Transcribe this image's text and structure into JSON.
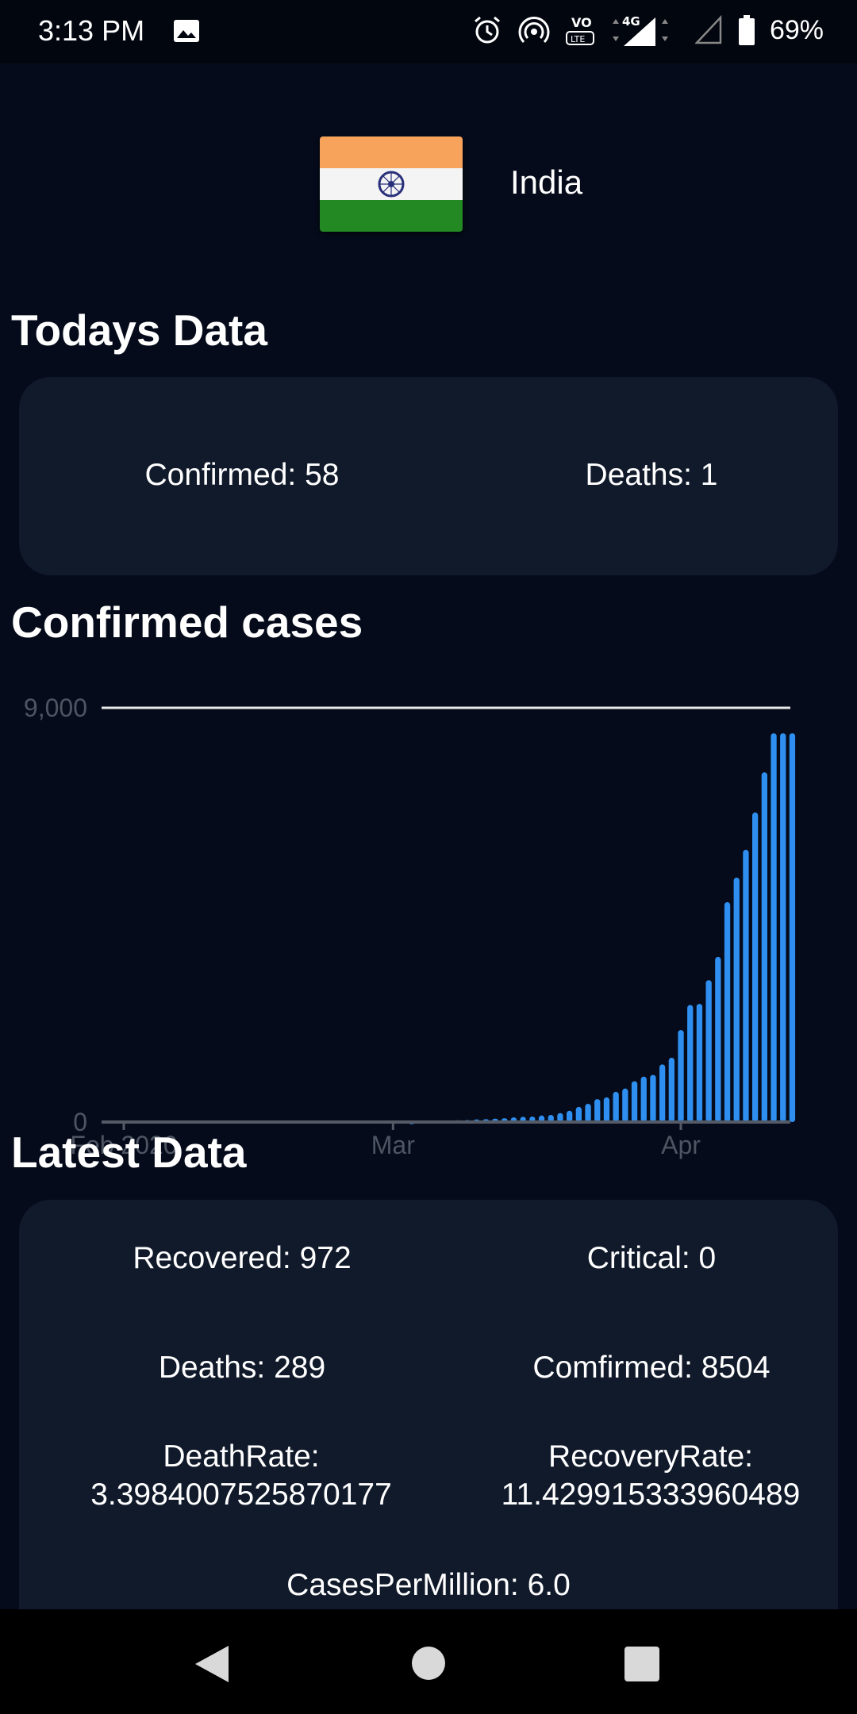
{
  "status_bar": {
    "time": "3:13 PM",
    "network": "4G",
    "battery": "69%",
    "icons": [
      "gallery-icon",
      "alarm-icon",
      "hotspot-icon",
      "volte-icon",
      "signal-icon",
      "battery-icon"
    ]
  },
  "header": {
    "country": "India",
    "flag_colors": [
      "#ff9933",
      "#ffffff",
      "#138808"
    ],
    "chakra_color": "#000080"
  },
  "today": {
    "title": "Todays Data",
    "confirmed": "Confirmed: 58",
    "deaths": "Deaths: 1"
  },
  "chart": {
    "title": "Confirmed cases"
  },
  "latest": {
    "title": "Latest Data",
    "recovered": "Recovered: 972",
    "critical": "Critical: 0",
    "deaths": "Deaths: 289",
    "confirmed": "Comfirmed: 8504",
    "death_rate_label": "DeathRate:",
    "death_rate_value": "3.3984007525870177",
    "recovery_rate_label": "RecoveryRate:",
    "recovery_rate_value": "11.429915333960489",
    "cases_per_million": "CasesPerMillion: 6.0"
  },
  "nav": {
    "icons": [
      "back-icon",
      "home-icon",
      "recents-icon"
    ]
  },
  "chart_data": {
    "type": "bar",
    "title": "",
    "xlabel": "",
    "ylabel": "",
    "ylim": [
      0,
      9000
    ],
    "y_ticks": [
      "0",
      "9,000"
    ],
    "x_ticks": [
      "Feb 2020",
      "Mar",
      "Apr"
    ],
    "x_tick_dates": [
      "2020-02-01",
      "2020-03-01",
      "2020-04-01"
    ],
    "grid": false,
    "bar_color": "#2f8ff0",
    "x": [
      "2020-03-03",
      "2020-03-04",
      "2020-03-05",
      "2020-03-06",
      "2020-03-07",
      "2020-03-08",
      "2020-03-09",
      "2020-03-10",
      "2020-03-11",
      "2020-03-12",
      "2020-03-13",
      "2020-03-14",
      "2020-03-15",
      "2020-03-16",
      "2020-03-17",
      "2020-03-18",
      "2020-03-19",
      "2020-03-20",
      "2020-03-21",
      "2020-03-22",
      "2020-03-23",
      "2020-03-24",
      "2020-03-25",
      "2020-03-26",
      "2020-03-27",
      "2020-03-28",
      "2020-03-29",
      "2020-03-30",
      "2020-03-31",
      "2020-04-01",
      "2020-04-02",
      "2020-04-03",
      "2020-04-04",
      "2020-04-05",
      "2020-04-06",
      "2020-04-07",
      "2020-04-08",
      "2020-04-09",
      "2020-04-10",
      "2020-04-11",
      "2020-04-12",
      "2020-04-13"
    ],
    "values": [
      5,
      28,
      30,
      31,
      34,
      39,
      43,
      56,
      62,
      73,
      82,
      102,
      113,
      119,
      142,
      156,
      194,
      244,
      330,
      396,
      499,
      536,
      657,
      727,
      887,
      987,
      1024,
      1251,
      1397,
      1998,
      2543,
      2567,
      3082,
      3588,
      4778,
      5311,
      5916,
      6725,
      7598,
      8446,
      8446,
      8446
    ]
  }
}
